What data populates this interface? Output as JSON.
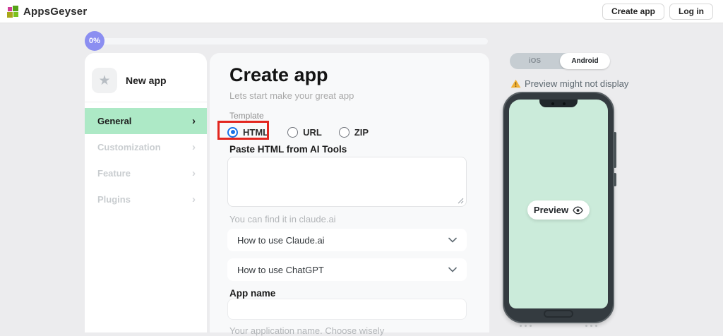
{
  "header": {
    "brand": "AppsGeyser",
    "create_app_label": "Create app",
    "login_label": "Log in"
  },
  "progress": {
    "percent": "0%"
  },
  "sidebar": {
    "app_title": "New app",
    "star_icon": "★",
    "chevron": "›",
    "items": [
      {
        "label": "General",
        "active": true
      },
      {
        "label": "Customization",
        "active": false
      },
      {
        "label": "Feature",
        "active": false
      },
      {
        "label": "Plugins",
        "active": false
      }
    ]
  },
  "main": {
    "title": "Create app",
    "subtitle": "Lets start make your great app",
    "template_label": "Template",
    "template_options": [
      "HTML",
      "URL",
      "ZIP"
    ],
    "selected_template": "HTML",
    "paste_label": "Paste HTML from AI Tools",
    "paste_value": "",
    "paste_hint": "You can find it in claude.ai",
    "dropdown_claude": "How to use Claude.ai",
    "dropdown_chatgpt": "How to use ChatGPT",
    "app_name_label": "App name",
    "app_name_value": "",
    "app_name_hint": "Your application name. Choose wisely"
  },
  "preview": {
    "ios_label": "iOS",
    "android_label": "Android",
    "selected_platform": "Android",
    "warning_text": "Preview might not display",
    "preview_button_label": "Preview"
  },
  "colors": {
    "accent_green": "#ade9c6",
    "progress_purple": "#8b8ef1",
    "phone_screen_green": "#cbebda",
    "radio_selected_blue": "#1a73e8",
    "annotation_red": "#e2261f",
    "warning_orange": "#f2b137",
    "page_background": "#ececee"
  }
}
